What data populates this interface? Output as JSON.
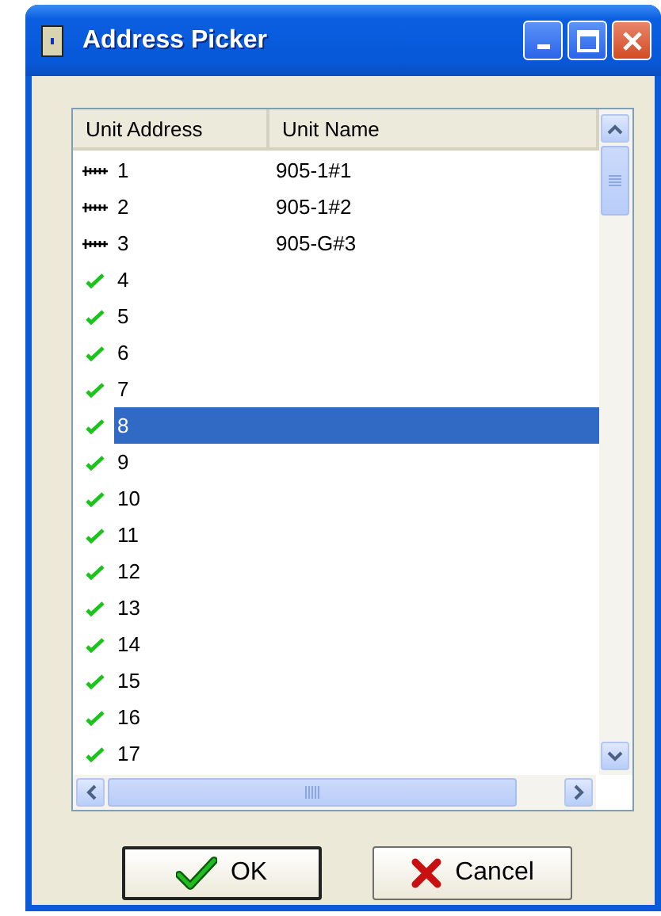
{
  "window": {
    "title": "Address Picker"
  },
  "list": {
    "columns": [
      "Unit Address",
      "Unit Name"
    ],
    "rows": [
      {
        "kind": "device",
        "address": "1",
        "name": "905-1#1",
        "selected": false
      },
      {
        "kind": "device",
        "address": "2",
        "name": "905-1#2",
        "selected": false
      },
      {
        "kind": "device",
        "address": "3",
        "name": "905-G#3",
        "selected": false
      },
      {
        "kind": "check",
        "address": "4",
        "selected": false
      },
      {
        "kind": "check",
        "address": "5",
        "selected": false
      },
      {
        "kind": "check",
        "address": "6",
        "selected": false
      },
      {
        "kind": "check",
        "address": "7",
        "selected": false
      },
      {
        "kind": "check",
        "address": "8",
        "selected": true
      },
      {
        "kind": "check",
        "address": "9",
        "selected": false
      },
      {
        "kind": "check",
        "address": "10",
        "selected": false
      },
      {
        "kind": "check",
        "address": "11",
        "selected": false
      },
      {
        "kind": "check",
        "address": "12",
        "selected": false
      },
      {
        "kind": "check",
        "address": "13",
        "selected": false
      },
      {
        "kind": "check",
        "address": "14",
        "selected": false
      },
      {
        "kind": "check",
        "address": "15",
        "selected": false
      },
      {
        "kind": "check",
        "address": "16",
        "selected": false
      },
      {
        "kind": "check",
        "address": "17",
        "selected": false
      }
    ]
  },
  "buttons": [
    {
      "kind": "ok",
      "label": "OK"
    },
    {
      "kind": "cancel",
      "label": "Cancel"
    }
  ]
}
